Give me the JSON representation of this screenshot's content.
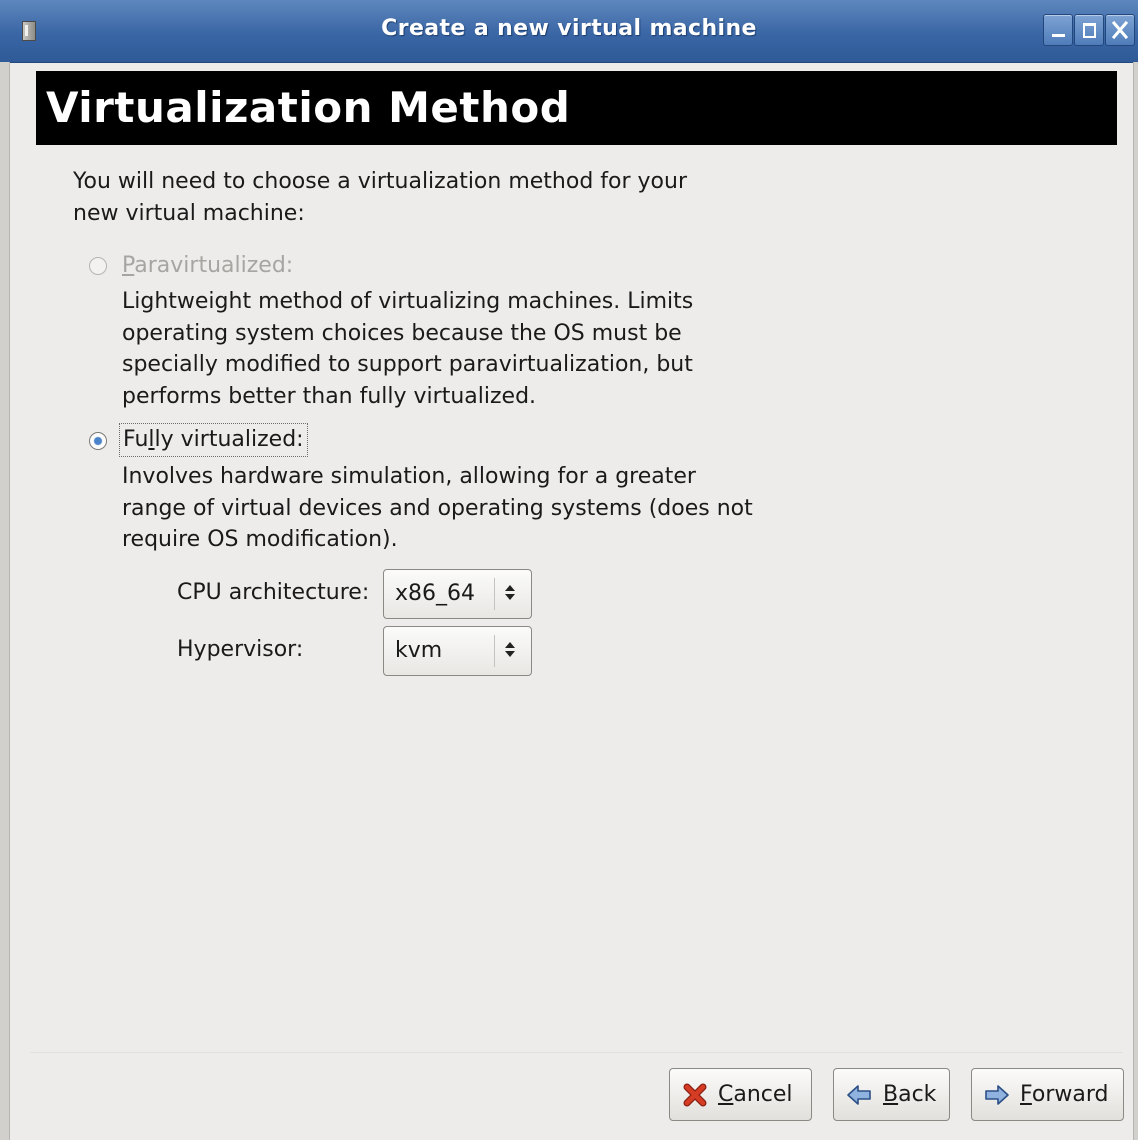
{
  "window": {
    "title": "Create a new virtual machine"
  },
  "page": {
    "heading": "Virtualization Method",
    "intro": "You will need to choose a virtualization method for your new virtual machine:"
  },
  "options": {
    "paravirtualized": {
      "mnemonic": "P",
      "label_rest": "aravirtualized:",
      "description": "Lightweight method of virtualizing machines. Limits operating system choices because the OS must be specially modified to support paravirtualization, but performs better than fully virtualized.",
      "enabled": false,
      "selected": false
    },
    "fully_virtualized": {
      "mnemonic": "F",
      "label_middle": "u",
      "label_mnemonic2": "l",
      "label_rest": "ly virtualized:",
      "description": "Involves hardware simulation, allowing for a greater range of virtual devices and operating systems (does not require OS modification).",
      "enabled": true,
      "selected": true
    }
  },
  "fields": {
    "cpu_architecture": {
      "label": "CPU architecture:",
      "value": "x86_64"
    },
    "hypervisor": {
      "label": "Hypervisor:",
      "value": "kvm"
    }
  },
  "buttons": {
    "cancel": {
      "mnemonic": "C",
      "rest": "ancel",
      "icon": "cancel-x-icon"
    },
    "back": {
      "mnemonic": "B",
      "rest": "ack",
      "icon": "back-arrow-icon"
    },
    "forward": {
      "mnemonic": "F",
      "rest": "orward",
      "icon": "forward-arrow-icon"
    }
  },
  "colors": {
    "titlebar": "#3a66a5",
    "header_bg": "#000000",
    "radio_selected": "#4a83c9",
    "disabled_text": "#a6a5a1"
  }
}
